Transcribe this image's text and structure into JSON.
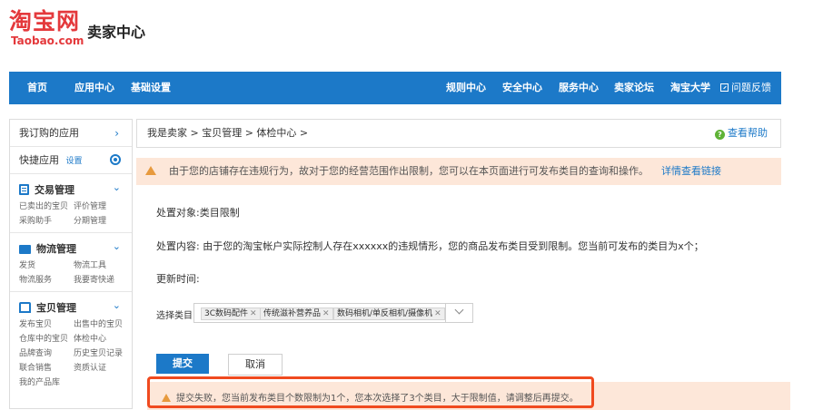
{
  "logo": {
    "cn": "淘宝网",
    "en": "Taobao.com"
  },
  "seller_center_title": "卖家中心",
  "nav": {
    "left": [
      "首页",
      "应用中心",
      "基础设置"
    ],
    "right": [
      "规则中心",
      "安全中心",
      "服务中心",
      "卖家论坛",
      "淘宝大学"
    ],
    "feedback": "问题反馈"
  },
  "sidebar": {
    "subscribed_apps": "我订购的应用",
    "quick_apps": "快捷应用",
    "quick_settings": "设置",
    "groups": [
      {
        "title": "交易管理",
        "icon": "document-icon",
        "links": [
          "已卖出的宝贝",
          "评价管理",
          "采购助手",
          "分期管理"
        ]
      },
      {
        "title": "物流管理",
        "icon": "truck-icon",
        "links": [
          "发货",
          "物流工具",
          "物流服务",
          "我要寄快递"
        ]
      },
      {
        "title": "宝贝管理",
        "icon": "shirt-icon",
        "links": [
          "发布宝贝",
          "出售中的宝贝",
          "仓库中的宝贝",
          "体检中心",
          "品牌查询",
          "历史宝贝记录",
          "联合销售",
          "资质认证",
          "我的产品库"
        ]
      }
    ]
  },
  "breadcrumb": "我是卖家 > 宝贝管理 > 体检中心 >",
  "help_link": "查看帮助",
  "notice": {
    "text": "由于您的店铺存在违规行为，故对于您的经营范围作出限制，您可以在本页面进行可发布类目的查询和操作。",
    "link": "详情查看链接"
  },
  "content": {
    "target": "处置对象:类目限制",
    "detail": "处置内容: 由于您的淘宝帐户实际控制人存在xxxxxx的违规情形，您的商品发布类目受到限制。您当前可发布的类目为x个；",
    "update_time": "更新时间:"
  },
  "category_select": {
    "label": "选择类目：",
    "tags": [
      "3C数码配件",
      "传统滋补营养品",
      "数码相机/单反相机/摄像机"
    ]
  },
  "buttons": {
    "submit": "提交",
    "cancel": "取消"
  },
  "error_message": "提交失败，您当前发布类目个数限制为1个，您本次选择了3个类目，大于限制值，请调整后再提交。",
  "colors": {
    "nav_blue": "#1c79c8",
    "brand_red": "#e4393c",
    "notice_bg": "#fde7d9",
    "highlight": "#f04a1f"
  }
}
